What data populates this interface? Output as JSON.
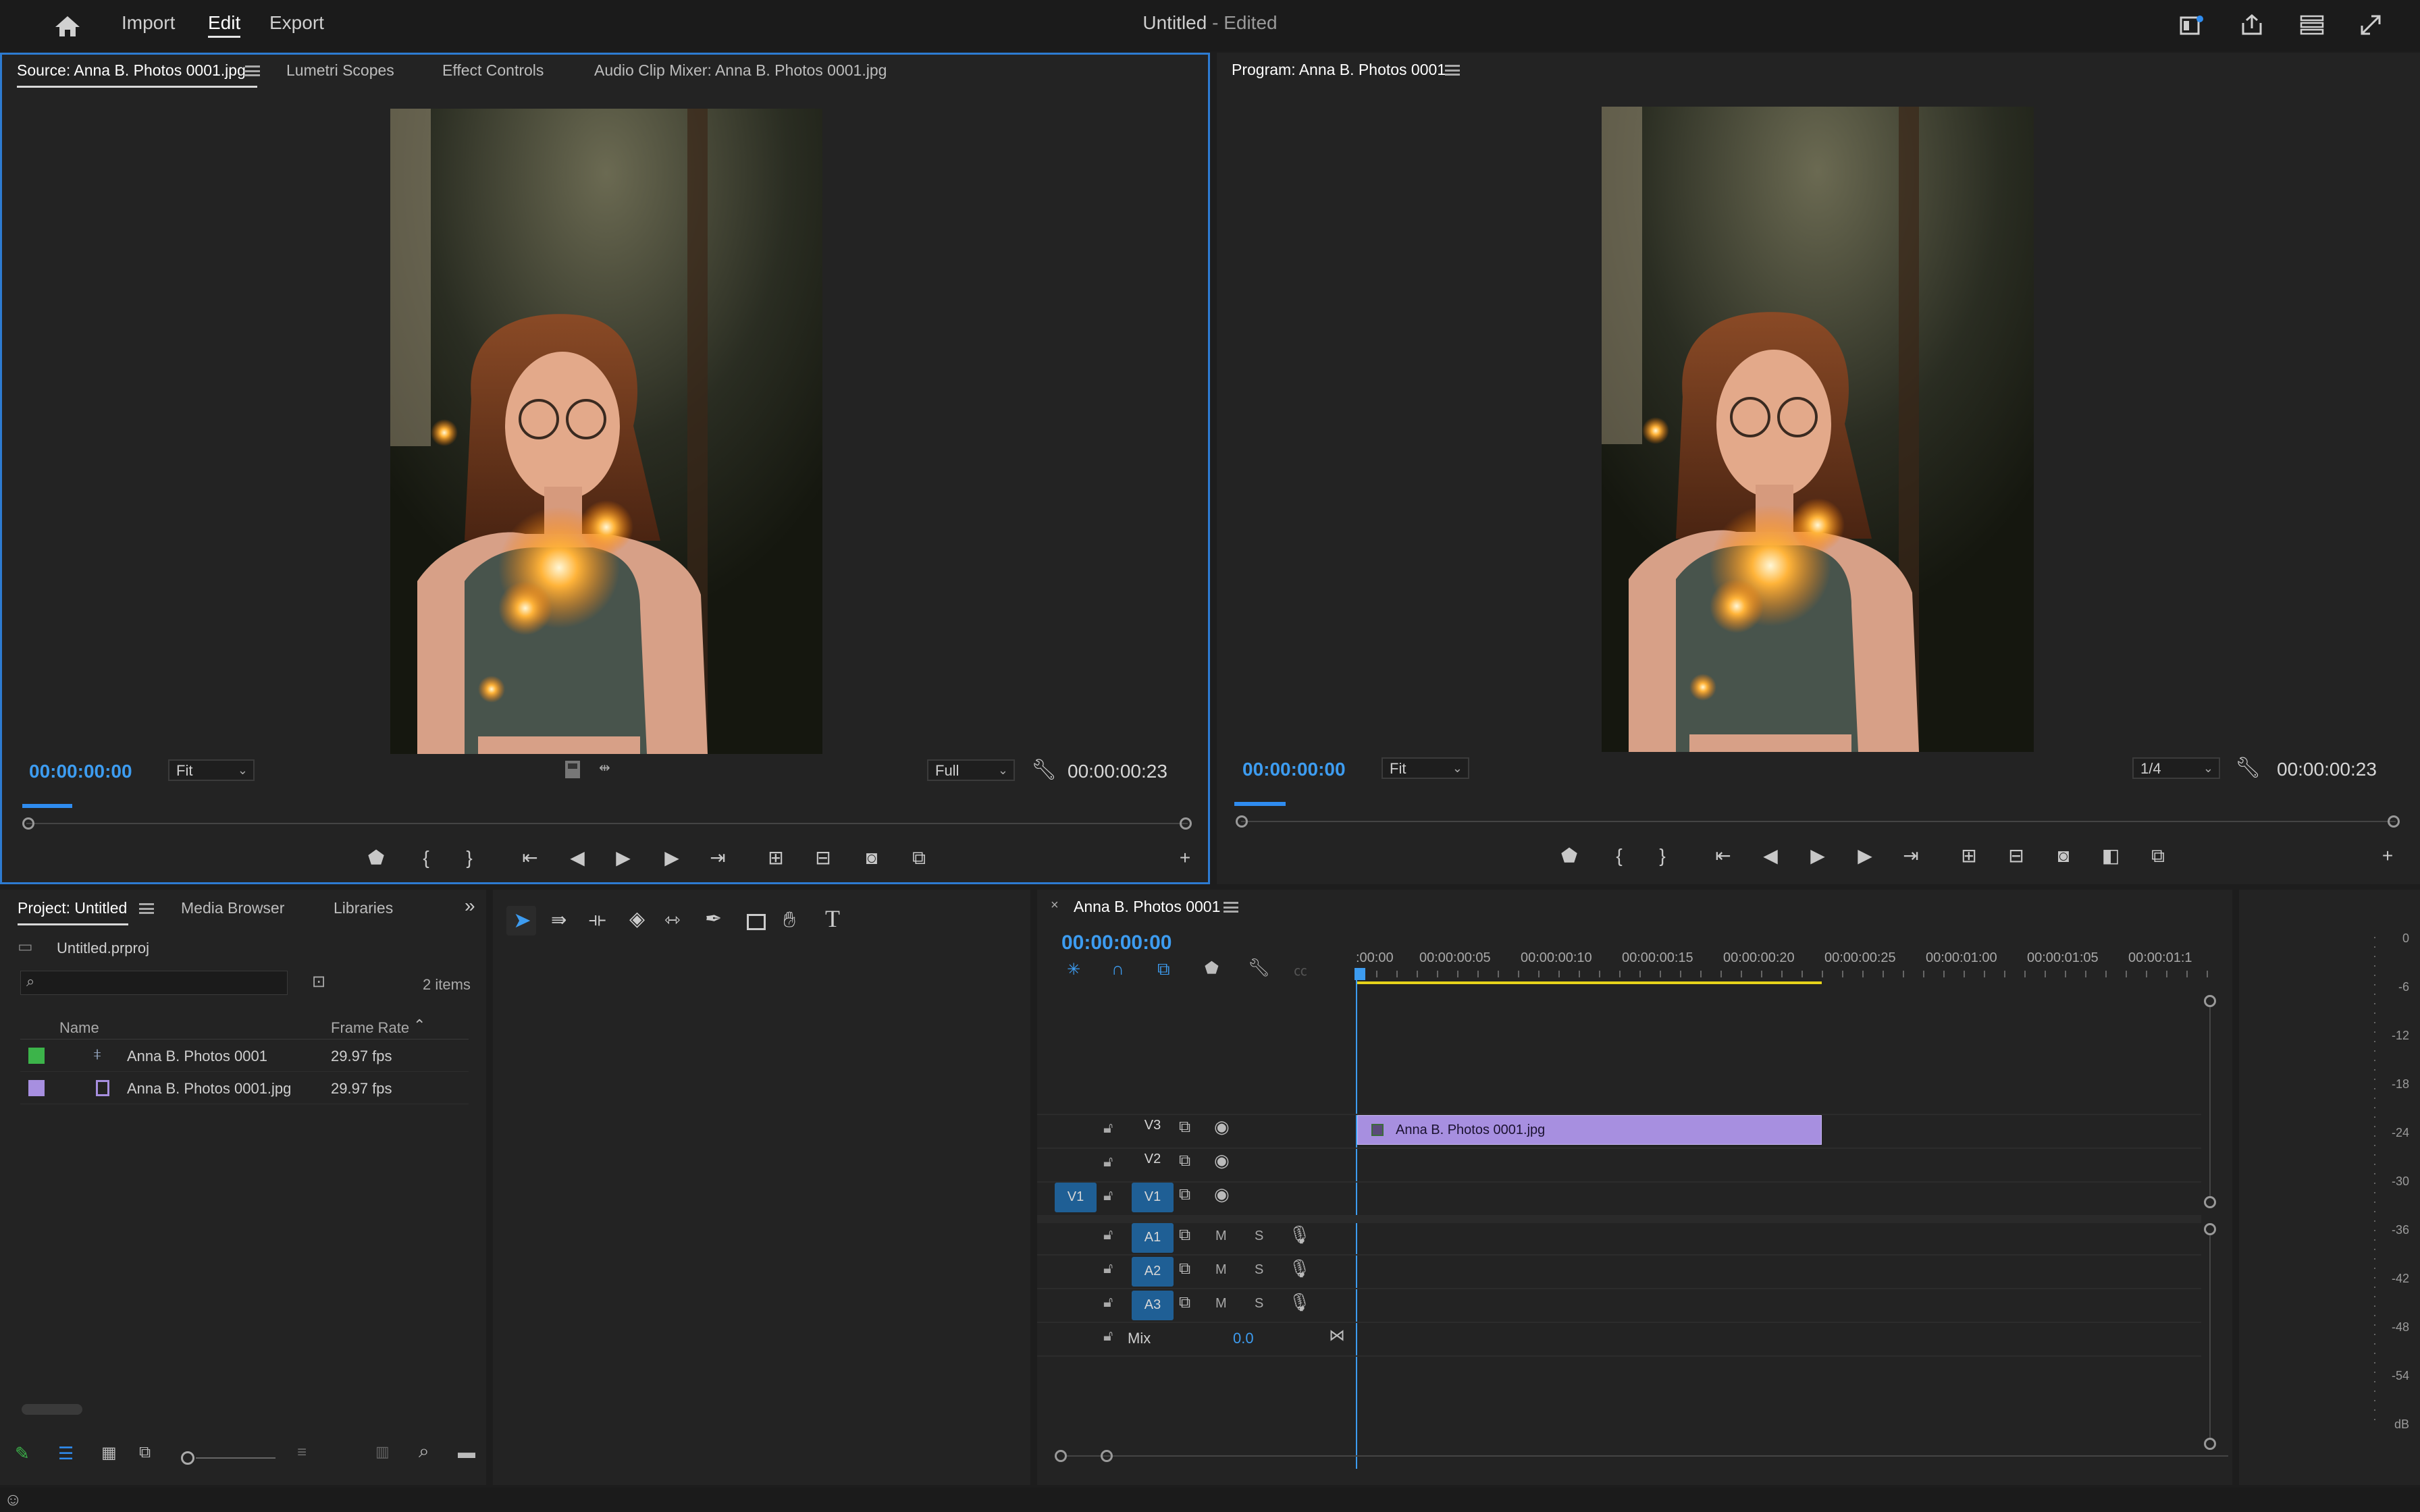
{
  "topbar": {
    "nav": [
      "Import",
      "Edit",
      "Export"
    ],
    "active_nav": "Edit",
    "title": "Untitled",
    "title_suffix": " - Edited"
  },
  "source_monitor": {
    "tabs": [
      "Source: Anna B. Photos 0001.jpg",
      "Lumetri Scopes",
      "Effect Controls",
      "Audio Clip Mixer: Anna B. Photos 0001.jpg"
    ],
    "timecode_in": "00:00:00:00",
    "zoom": "Fit",
    "quality": "Full",
    "duration": "00:00:00:23"
  },
  "program_monitor": {
    "title": "Program: Anna B. Photos 0001",
    "timecode_in": "00:00:00:00",
    "zoom": "Fit",
    "quality": "1/4",
    "duration": "00:00:00:23"
  },
  "project": {
    "tabs": [
      "Project: Untitled",
      "Media Browser",
      "Libraries"
    ],
    "file": "Untitled.prproj",
    "item_count": "2 items",
    "columns": [
      "Name",
      "Frame Rate"
    ],
    "items": [
      {
        "name": "Anna B. Photos 0001",
        "frame_rate": "29.97 fps",
        "color": "#3cb44a",
        "kind": "sequence"
      },
      {
        "name": "Anna B. Photos 0001.jpg",
        "frame_rate": "29.97 fps",
        "color": "#a78fe0",
        "kind": "still"
      }
    ]
  },
  "timeline": {
    "sequence": "Anna B. Photos 0001",
    "timecode": "00:00:00:00",
    "ruler": [
      ":00:00",
      "00:00:00:05",
      "00:00:00:10",
      "00:00:00:15",
      "00:00:00:20",
      "00:00:00:25",
      "00:00:01:00",
      "00:00:01:05",
      "00:00:01:1"
    ],
    "video_tracks": [
      "V3",
      "V2",
      "V1"
    ],
    "audio_tracks": [
      "A1",
      "A2",
      "A3"
    ],
    "source_patch": "V1",
    "mute": "M",
    "solo": "S",
    "mix_label": "Mix",
    "mix_value": "0.0",
    "clip_name": "Anna B. Photos 0001.jpg",
    "clip_color": "#a78fe0"
  },
  "meter": {
    "labels": [
      "0",
      "-6",
      "-12",
      "-18",
      "-24",
      "-30",
      "-36",
      "-42",
      "-48",
      "-54",
      "dB"
    ]
  }
}
